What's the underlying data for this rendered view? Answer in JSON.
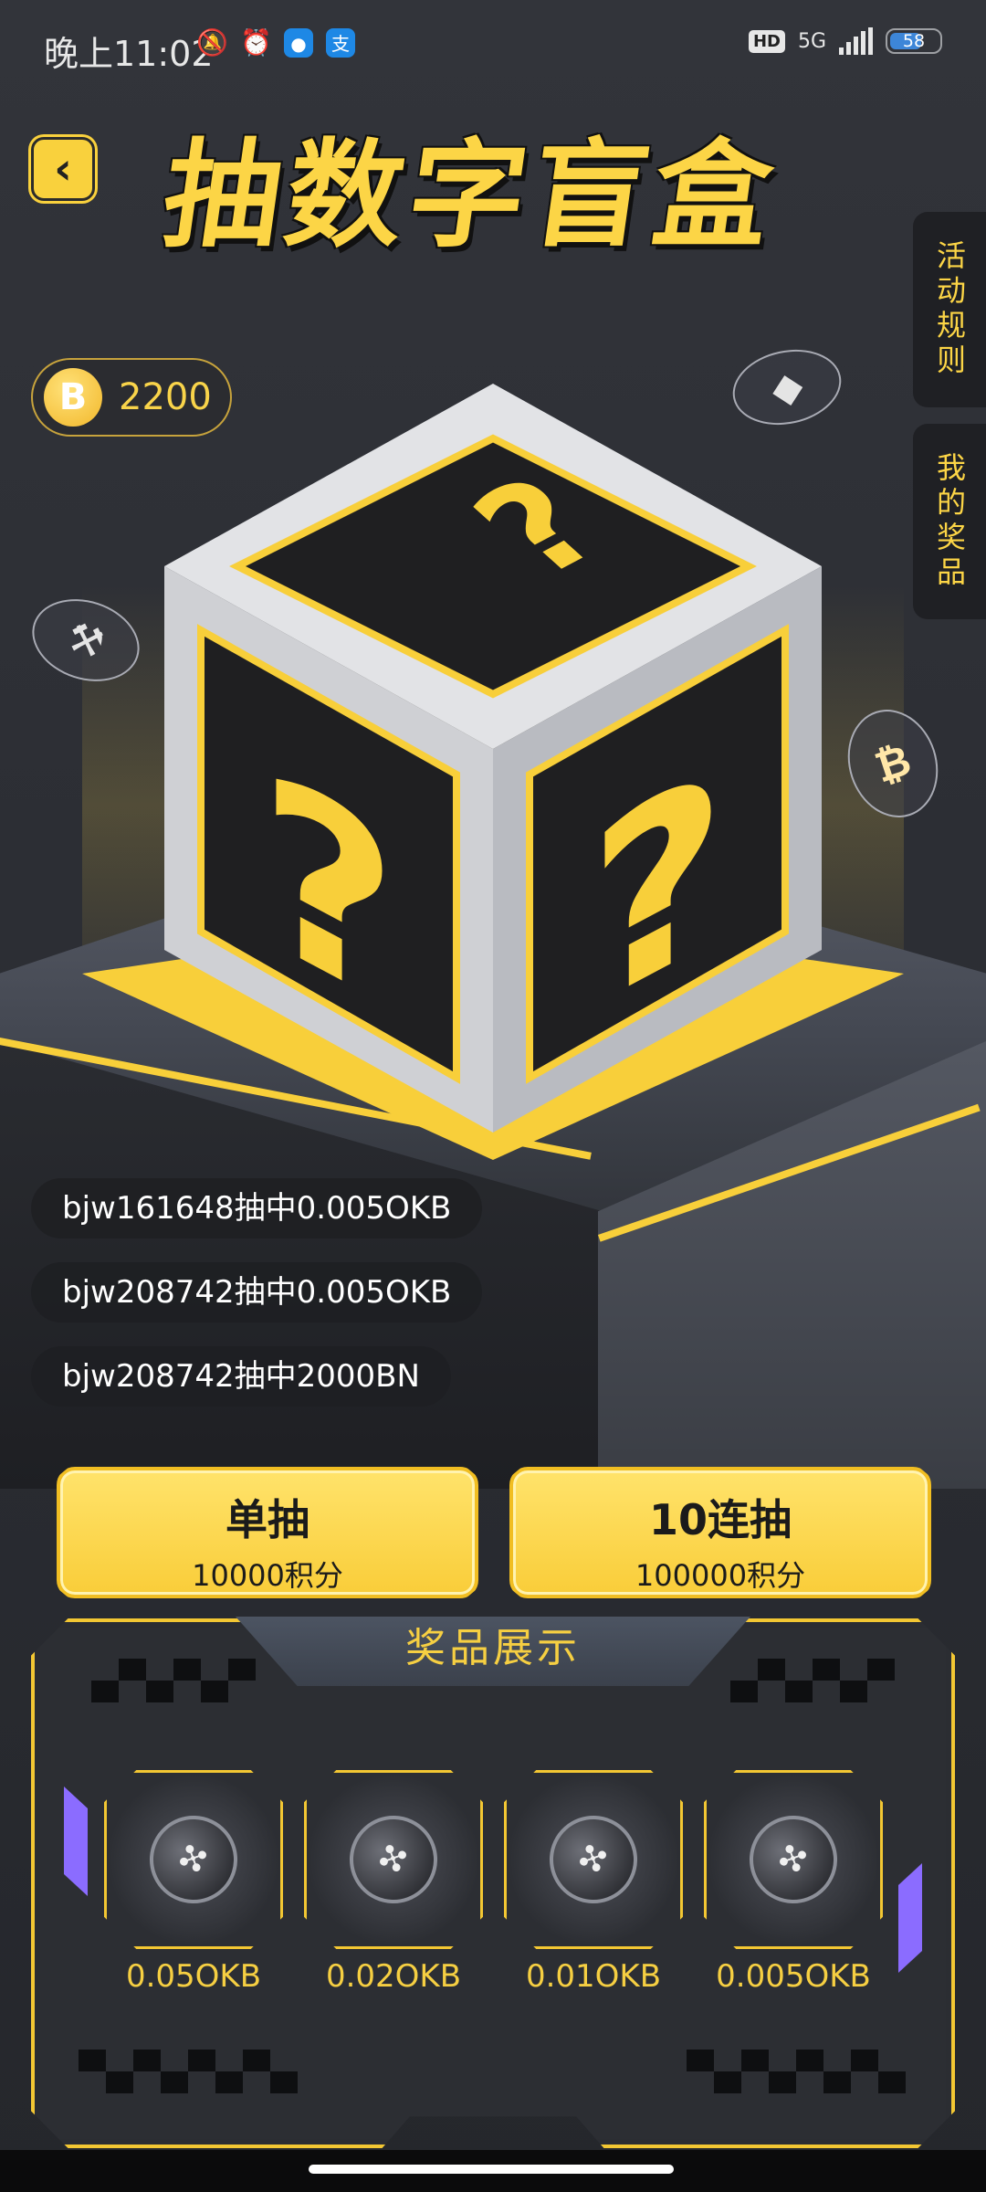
{
  "status_bar": {
    "time": "晚上11:02",
    "network": "5G",
    "hd": "HD",
    "battery": "58"
  },
  "header": {
    "title": "抽数字盲盒",
    "back_icon": "chevron-left-icon"
  },
  "side_tabs": {
    "rules": "活动规则",
    "my_prizes": "我的奖品"
  },
  "points": {
    "coin_symbol": "B",
    "value": "2200"
  },
  "ticker": [
    "bjw161648抽中0.005OKB",
    "bjw208742抽中0.005OKB",
    "bjw208742抽中2000BN"
  ],
  "draw_buttons": {
    "single": {
      "label": "单抽",
      "cost": "10000积分"
    },
    "ten": {
      "label": "10连抽",
      "cost": "100000积分"
    }
  },
  "showcase": {
    "title": "奖品展示",
    "prizes": [
      "0.05OKB",
      "0.02OKB",
      "0.01OKB",
      "0.005OKB"
    ]
  },
  "colors": {
    "accent": "#f9d13d",
    "background": "#2e3035",
    "purple_accent": "#8b6cff"
  }
}
